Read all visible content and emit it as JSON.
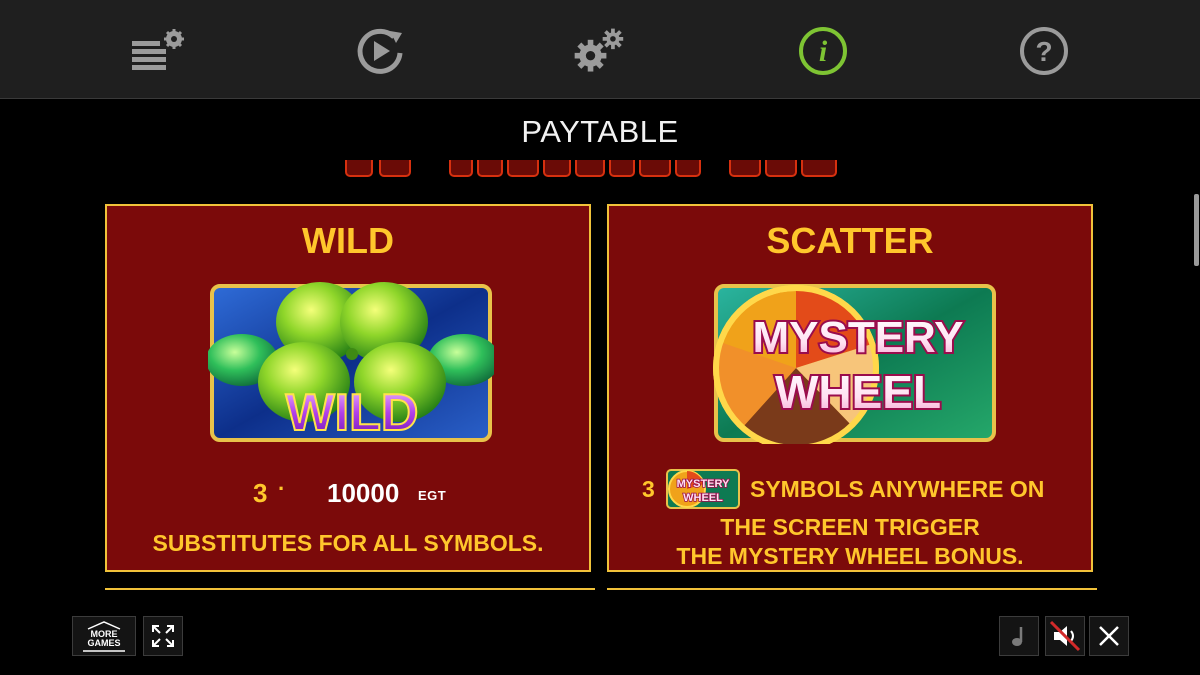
{
  "toolbar": {
    "items": [
      {
        "icon": "paytable-settings-icon"
      },
      {
        "icon": "autoplay-icon"
      },
      {
        "icon": "settings-icon"
      },
      {
        "icon": "info-icon",
        "active": true,
        "active_color": "#7ec433"
      },
      {
        "icon": "help-icon"
      }
    ],
    "icon_color": "#9b9b9b"
  },
  "page": {
    "title": "PAYTABLE"
  },
  "colors": {
    "panel_bg": "#7b0a0a",
    "panel_border": "#f1c23a",
    "accent_text": "#ffc72c"
  },
  "wild": {
    "title": "WILD",
    "symbol_text": "WILD",
    "pay_count": "3",
    "pay_separator": "·",
    "pay_value": "10000",
    "pay_unit": "EGT",
    "description": "SUBSTITUTES FOR ALL SYMBOLS."
  },
  "scatter": {
    "title": "SCATTER",
    "symbol_text_line1": "MYSTERY",
    "symbol_text_line2": "WHEEL",
    "count": "3",
    "mini_text_line1": "MYSTERY",
    "mini_text_line2": "WHEEL",
    "desc_line1": "SYMBOLS ANYWHERE ON",
    "desc_line2": "THE SCREEN TRIGGER",
    "desc_line3": "THE MYSTERY WHEEL BONUS."
  },
  "bottom": {
    "more_games_line1": "MORE",
    "more_games_line2": "GAMES"
  }
}
